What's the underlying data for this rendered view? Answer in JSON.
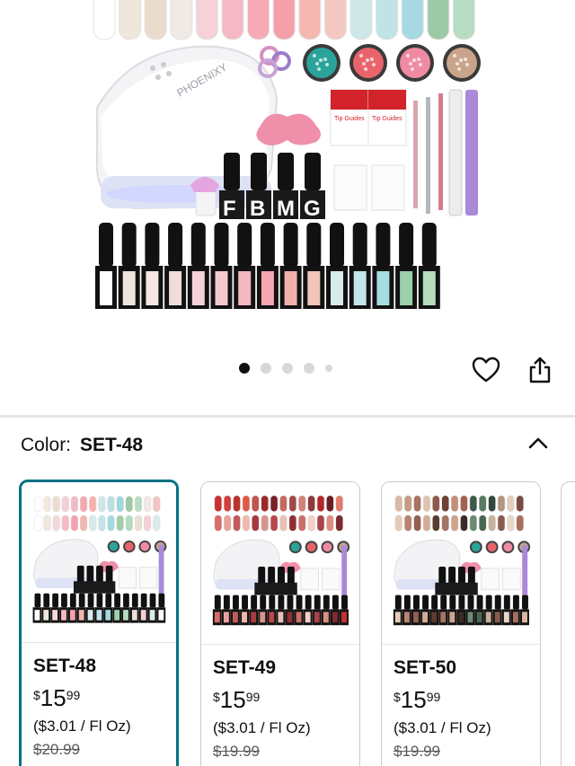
{
  "product_image": {
    "brand": "PHOENIXY",
    "bottle_label": "PHOENIXY",
    "nail_guide_label": "Tip Guides",
    "top_coat_letters": [
      "F",
      "B",
      "M",
      "G"
    ],
    "top_swatch_colors": [
      "#ffffff",
      "#efe6dc",
      "#e9dccd",
      "#f0e9e4",
      "#f6d2d8",
      "#f4b9c4",
      "#f7a9b4",
      "#f5a0a9",
      "#f6b7b0",
      "#f2c8c0",
      "#cfe6e6",
      "#bfe3e6",
      "#a6d9e2",
      "#9cc9a6",
      "#b8dcc1"
    ],
    "bottle_stripes": [
      "#ffffff",
      "#efe5da",
      "#f5e7e1",
      "#f0ddd8",
      "#f5d2d8",
      "#f3c9cf",
      "#f4b8c0",
      "#f7a7b2",
      "#f1b0ac",
      "#f2c4bb",
      "#d8ecea",
      "#c5e6e9",
      "#a7dce2",
      "#9ccfaa",
      "#b6dcbd"
    ],
    "glitter_colors": [
      "#2aa39a",
      "#e8646a",
      "#f08aa2",
      "#c9a38a"
    ]
  },
  "carousel": {
    "dot_count": 5,
    "active_index": 0
  },
  "icons": {
    "wishlist": "heart-icon",
    "share": "share-icon",
    "collapse": "chevron-up-icon"
  },
  "color_selector": {
    "label": "Color:",
    "selected": "SET-48"
  },
  "variants": [
    {
      "name": "SET-48",
      "price_symbol": "$",
      "price_whole": "15",
      "price_fraction": "99",
      "unit_price": "($3.01 / Fl Oz)",
      "list_price": "$20.99",
      "selected": true,
      "swatches_row1": [
        "#ffffff",
        "#f1e8de",
        "#eadccf",
        "#f5d0d6",
        "#f4bac4",
        "#f6a8b3",
        "#f5b3ac",
        "#cfe6e6",
        "#b8e0e5",
        "#a0d7df",
        "#9cc9a6",
        "#b9ddc2",
        "#f0e9e4",
        "#f2c6c0"
      ],
      "swatches_row2": [
        "#ffffff",
        "#efe6dc",
        "#f3d8dc",
        "#f7b9c4",
        "#f6a0ae",
        "#f0b6b0",
        "#d6ebea",
        "#c1e4e8",
        "#a3dae1",
        "#9fcfab",
        "#b3dbbe",
        "#e9e0d4",
        "#f5cfd4",
        "#d9ece9"
      ]
    },
    {
      "name": "SET-49",
      "price_symbol": "$",
      "price_whole": "15",
      "price_fraction": "99",
      "unit_price": "($3.01 / Fl Oz)",
      "list_price": "$19.99",
      "selected": false,
      "swatches_row1": [
        "#c8312f",
        "#d2403a",
        "#b8322e",
        "#e05a4a",
        "#c4544f",
        "#9e2a2a",
        "#7a2025",
        "#c76a62",
        "#a04a48",
        "#d3817a",
        "#8d3a3e",
        "#b5262b",
        "#6e1e22",
        "#e27b6b"
      ],
      "swatches_row2": [
        "#d86b6b",
        "#e8a39a",
        "#c25a5a",
        "#f0b8ad",
        "#a53a3f",
        "#d9948a",
        "#b9474c",
        "#e9c0b5",
        "#8f2f36",
        "#cc6f6a",
        "#f3cfc6",
        "#a8444a",
        "#dd8e84",
        "#7d2a30"
      ]
    },
    {
      "name": "SET-50",
      "price_symbol": "$",
      "price_whole": "15",
      "price_fraction": "99",
      "unit_price": "($3.01 / Fl Oz)",
      "list_price": "$19.99",
      "selected": false,
      "swatches_row1": [
        "#d9b9a6",
        "#c79a84",
        "#a8735f",
        "#e0c2b2",
        "#8c5a4a",
        "#6f3f33",
        "#c48e7a",
        "#a3614f",
        "#3e5a4a",
        "#5a7a62",
        "#2f4a3c",
        "#b5967f",
        "#e3cfc1",
        "#7a4c3f"
      ],
      "swatches_row2": [
        "#e6cbbb",
        "#b98371",
        "#946050",
        "#d4ab98",
        "#5b3a30",
        "#a57563",
        "#cfa38f",
        "#3b2a25",
        "#6c8b72",
        "#4a6652",
        "#c7b19d",
        "#8a5b4c",
        "#e8d6c9",
        "#a86f5c"
      ]
    }
  ]
}
